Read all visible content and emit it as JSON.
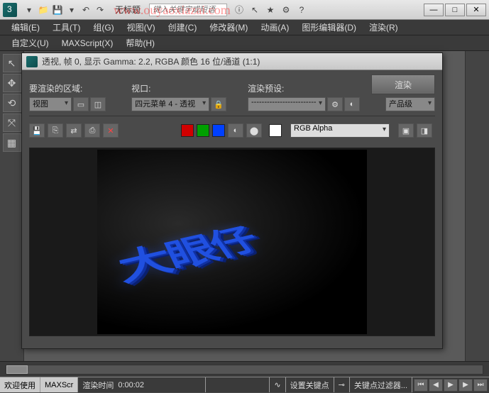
{
  "titlebar": {
    "title": "无标题",
    "search_placeholder": "键入关键字或短语"
  },
  "watermark": "www.ouyaoxiazai.com",
  "menu": {
    "edit": "编辑(E)",
    "tools": "工具(T)",
    "group": "组(G)",
    "views": "视图(V)",
    "create": "创建(C)",
    "modifiers": "修改器(M)",
    "animation": "动画(A)",
    "graph": "图形编辑器(D)",
    "render": "渲染(R)"
  },
  "menu2": {
    "customize": "自定义(U)",
    "maxscript": "MAXScript(X)",
    "help": "帮助(H)"
  },
  "render_window": {
    "title": "透视, 帧 0, 显示 Gamma: 2.2, RGBA 颜色 16 位/通道 (1:1)",
    "region_label": "要渲染的区域:",
    "region_value": "视图",
    "viewport_label": "视口:",
    "viewport_value": "四元菜单 4 - 透视",
    "preset_label": "渲染预设:",
    "preset_value": "-------------------------",
    "production_value": "产品级",
    "render_btn": "渲染",
    "channel": "RGB Alpha",
    "colors": {
      "red": "#d00000",
      "green": "#00a000",
      "blue": "#0040ff",
      "white": "#ffffff"
    },
    "scene_text": "大眼仔"
  },
  "status": {
    "welcome": "欢迎使用",
    "maxscript": "MAXScr",
    "render_time": "渲染时间",
    "time": "0:00:02",
    "set_key": "设置关键点",
    "key_filter": "关键点过滤器..."
  }
}
